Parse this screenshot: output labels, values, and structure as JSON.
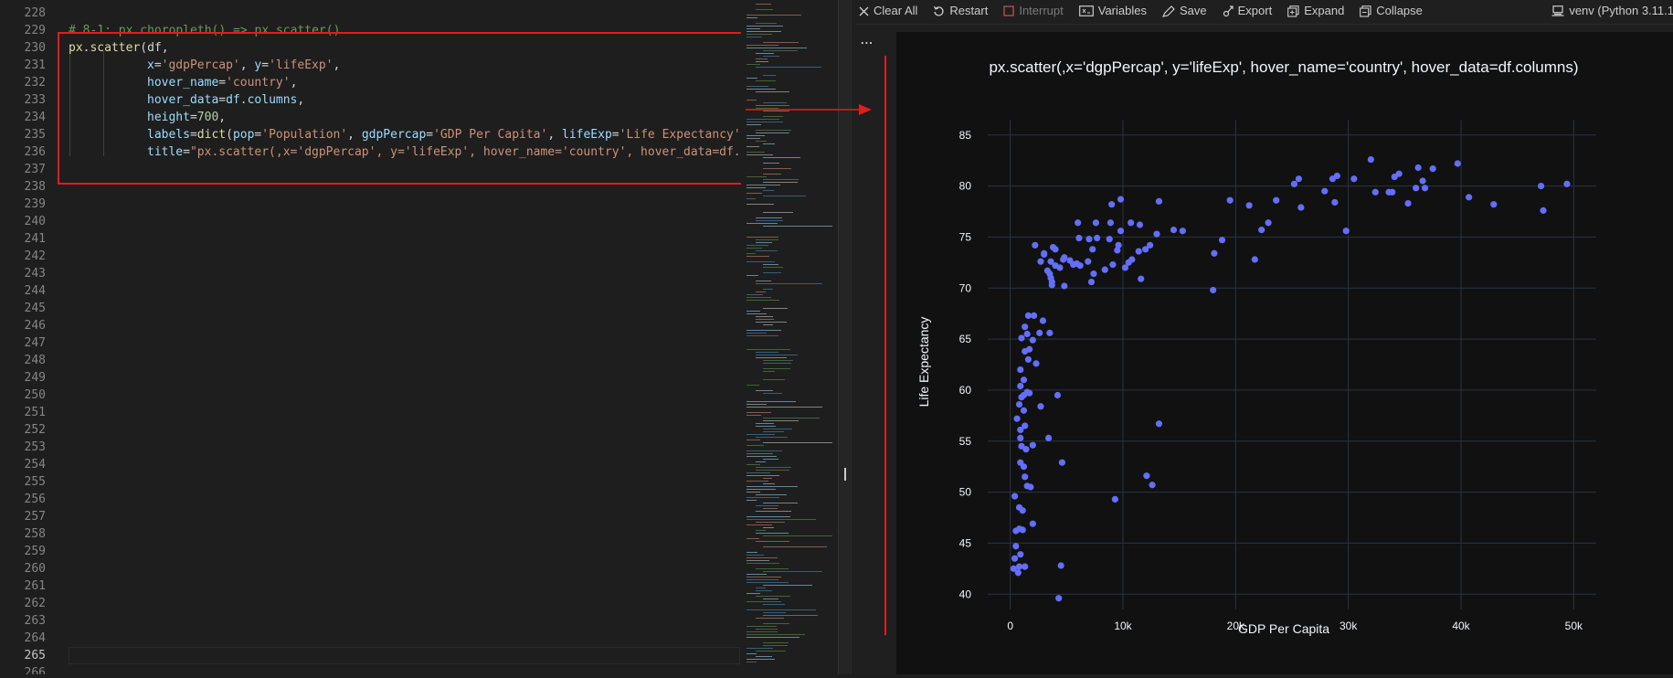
{
  "editor": {
    "line_numbers": [
      "228",
      "229",
      "230",
      "231",
      "232",
      "233",
      "234",
      "235",
      "236",
      "237",
      "238",
      "239",
      "240",
      "241",
      "242",
      "243",
      "244",
      "245",
      "246",
      "247",
      "248",
      "249",
      "250",
      "251",
      "252",
      "253",
      "254",
      "255",
      "256",
      "257",
      "258",
      "259",
      "260",
      "261",
      "262",
      "263",
      "264",
      "265",
      "266"
    ],
    "active_line": "265",
    "code": {
      "comment": "# 8-1: px.choropleth() => px.scatter()",
      "l230_fn": "px.scatter",
      "l230_rest": "(df,",
      "l231_kw": "x",
      "l231_s1": "'gdpPercap'",
      "l231_mid": ", ",
      "l231_kw2": "y",
      "l231_s2": "'lifeExp'",
      "l232_kw": "hover_name",
      "l232_s": "'country'",
      "l233_kw": "hover_data",
      "l233_v": "df.columns",
      "l234_kw": "height",
      "l234_n": "700",
      "l235_kw": "labels",
      "l235_fn": "dict",
      "l235_k1": "pop",
      "l235_s1": "'Population'",
      "l235_k2": "gdpPercap",
      "l235_s2": "'GDP Per Capita'",
      "l235_k3": "lifeExp",
      "l235_s3": "'Life Expectancy'",
      "l236_kw": "title",
      "l236_s": "\"px.scatter(,x='dgpPercap', y='lifeExp', hover_name='country', hover_data=df.co"
    }
  },
  "toolbar": {
    "clear_all": "Clear All",
    "restart": "Restart",
    "interrupt": "Interrupt",
    "variables": "Variables",
    "save": "Save",
    "export": "Export",
    "expand": "Expand",
    "collapse": "Collapse",
    "kernel": "venv (Python 3.11.1"
  },
  "output": {
    "more": "..."
  },
  "colors": {
    "marker": "#636efa",
    "plot_bg": "#111111",
    "grid": "#283442",
    "annotation": "#e51b1b"
  },
  "chart_data": {
    "type": "scatter",
    "title": "px.scatter(,x='dgpPercap', y='lifeExp', hover_name='country', hover_data=df.columns)",
    "xlabel": "GDP Per Capita",
    "ylabel": "Life Expectancy",
    "xlim": [
      -2000,
      52000
    ],
    "ylim": [
      38.5,
      86.5
    ],
    "xticks": [
      0,
      10000,
      20000,
      30000,
      40000,
      50000
    ],
    "xtick_labels": [
      "0",
      "10k",
      "20k",
      "30k",
      "40k",
      "50k"
    ],
    "yticks": [
      40,
      45,
      50,
      55,
      60,
      65,
      70,
      75,
      80,
      85
    ],
    "ytick_labels": [
      "40",
      "45",
      "50",
      "55",
      "60",
      "65",
      "70",
      "75",
      "80",
      "85"
    ],
    "grid": true,
    "points": [
      [
        300,
        42.5
      ],
      [
        400,
        43.5
      ],
      [
        500,
        44.7
      ],
      [
        500,
        46.2
      ],
      [
        700,
        42.1
      ],
      [
        800,
        42.7
      ],
      [
        800,
        46.4
      ],
      [
        900,
        43.9
      ],
      [
        1100,
        46.3
      ],
      [
        1300,
        42.7
      ],
      [
        2000,
        46.9
      ],
      [
        4500,
        42.8
      ],
      [
        4300,
        39.6
      ],
      [
        400,
        49.6
      ],
      [
        800,
        48.5
      ],
      [
        1100,
        48.2
      ],
      [
        1500,
        50.6
      ],
      [
        1800,
        50.5
      ],
      [
        900,
        52.9
      ],
      [
        1200,
        52.5
      ],
      [
        1300,
        51.5
      ],
      [
        1400,
        54.2
      ],
      [
        2000,
        54.6
      ],
      [
        1000,
        54.5
      ],
      [
        900,
        55.3
      ],
      [
        3400,
        55.3
      ],
      [
        4600,
        52.9
      ],
      [
        600,
        57.2
      ],
      [
        800,
        58.6
      ],
      [
        900,
        56.1
      ],
      [
        1300,
        56.5
      ],
      [
        1200,
        58.0
      ],
      [
        1500,
        59.8
      ],
      [
        1700,
        59.7
      ],
      [
        1000,
        59.3
      ],
      [
        1200,
        59.5
      ],
      [
        2700,
        58.4
      ],
      [
        4200,
        59.5
      ],
      [
        900,
        60.4
      ],
      [
        1200,
        61.0
      ],
      [
        900,
        62.0
      ],
      [
        1300,
        63.8
      ],
      [
        1600,
        63.0
      ],
      [
        1700,
        64.0
      ],
      [
        2300,
        62.6
      ],
      [
        1000,
        65.1
      ],
      [
        1500,
        65.5
      ],
      [
        2000,
        64.9
      ],
      [
        2600,
        65.6
      ],
      [
        3500,
        65.6
      ],
      [
        1300,
        66.2
      ],
      [
        1600,
        67.3
      ],
      [
        2900,
        66.8
      ],
      [
        2100,
        67.3
      ],
      [
        4800,
        70.2
      ],
      [
        3700,
        70.3
      ],
      [
        3700,
        70.6
      ],
      [
        3600,
        71.0
      ],
      [
        3300,
        71.7
      ],
      [
        3500,
        71.4
      ],
      [
        4000,
        72.2
      ],
      [
        4400,
        72.0
      ],
      [
        4700,
        72.8
      ],
      [
        5600,
        72.3
      ],
      [
        5900,
        72.4
      ],
      [
        6200,
        72.2
      ],
      [
        4800,
        73.0
      ],
      [
        4000,
        73.8
      ],
      [
        2700,
        72.6
      ],
      [
        3000,
        73.3
      ],
      [
        3800,
        74.0
      ],
      [
        7200,
        70.6
      ],
      [
        6900,
        72.6
      ],
      [
        7400,
        71.4
      ],
      [
        8400,
        71.8
      ],
      [
        9100,
        72.3
      ],
      [
        9500,
        73.7
      ],
      [
        6100,
        74.9
      ],
      [
        7000,
        74.8
      ],
      [
        7700,
        74.9
      ],
      [
        8800,
        74.8
      ],
      [
        9600,
        74.2
      ],
      [
        10200,
        72.0
      ],
      [
        10500,
        72.5
      ],
      [
        10800,
        72.8
      ],
      [
        11400,
        73.6
      ],
      [
        11600,
        70.9
      ],
      [
        12000,
        73.8
      ],
      [
        12400,
        74.2
      ],
      [
        13000,
        75.3
      ],
      [
        11500,
        76.2
      ],
      [
        10700,
        76.4
      ],
      [
        9800,
        75.6
      ],
      [
        8900,
        76.4
      ],
      [
        7600,
        76.4
      ],
      [
        6000,
        76.4
      ],
      [
        5300,
        72.7
      ],
      [
        7300,
        73.8
      ],
      [
        2200,
        74.2
      ],
      [
        3000,
        73.4
      ],
      [
        3600,
        72.6
      ],
      [
        9000,
        78.2
      ],
      [
        9800,
        78.7
      ],
      [
        13200,
        78.5
      ],
      [
        14500,
        75.7
      ],
      [
        15300,
        75.6
      ],
      [
        18100,
        73.4
      ],
      [
        18800,
        74.7
      ],
      [
        19500,
        78.6
      ],
      [
        21200,
        78.1
      ],
      [
        21700,
        72.8
      ],
      [
        22300,
        75.7
      ],
      [
        22900,
        76.4
      ],
      [
        23600,
        78.6
      ],
      [
        18000,
        69.8
      ],
      [
        25200,
        80.2
      ],
      [
        25600,
        80.7
      ],
      [
        25800,
        77.9
      ],
      [
        27900,
        79.5
      ],
      [
        28600,
        80.7
      ],
      [
        28800,
        78.4
      ],
      [
        29000,
        81.0
      ],
      [
        29800,
        75.6
      ],
      [
        30500,
        80.7
      ],
      [
        32000,
        82.6
      ],
      [
        32400,
        79.4
      ],
      [
        33600,
        79.4
      ],
      [
        33900,
        79.4
      ],
      [
        34100,
        80.9
      ],
      [
        34500,
        81.2
      ],
      [
        35300,
        78.3
      ],
      [
        36000,
        79.8
      ],
      [
        36200,
        81.8
      ],
      [
        36600,
        80.5
      ],
      [
        36800,
        79.8
      ],
      [
        37500,
        81.7
      ],
      [
        39700,
        82.2
      ],
      [
        40700,
        78.9
      ],
      [
        42900,
        78.2
      ],
      [
        47100,
        80.0
      ],
      [
        47300,
        77.6
      ],
      [
        49400,
        80.2
      ],
      [
        13200,
        56.7
      ],
      [
        9300,
        49.3
      ],
      [
        12100,
        51.6
      ],
      [
        12600,
        50.7
      ]
    ]
  }
}
